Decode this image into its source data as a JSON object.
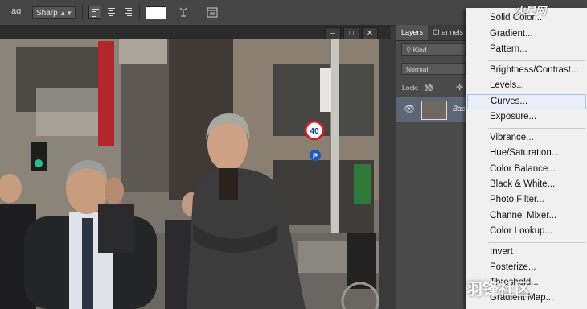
{
  "toolbar": {
    "aa_label": "aɑ",
    "antialias_value": "Sharp",
    "text_color": "#ffffff"
  },
  "window_controls": [
    "–",
    "□",
    "✕"
  ],
  "layers_panel": {
    "tabs": [
      "Layers",
      "Channels"
    ],
    "filter_kind": "Kind",
    "blend_mode": "Normal",
    "lock_label": "Lock:",
    "layer_name": "Bac..."
  },
  "photo": {
    "sign_number": "40",
    "parking_letter": "P"
  },
  "adjustment_menu": {
    "items": [
      "Solid Color...",
      "Gradient...",
      "Pattern...",
      "Brightness/Contrast...",
      "Levels...",
      "Curves...",
      "Exposure...",
      "Vibrance...",
      "Hue/Saturation...",
      "Color Balance...",
      "Black & White...",
      "Photo Filter...",
      "Channel Mixer...",
      "Color Lookup...",
      "Invert",
      "Posterize...",
      "Threshold...",
      "Gradient Map..."
    ],
    "highlighted": "Curves..."
  },
  "watermarks": {
    "top_right": "火星网",
    "bottom_right": "羽锋社区"
  }
}
